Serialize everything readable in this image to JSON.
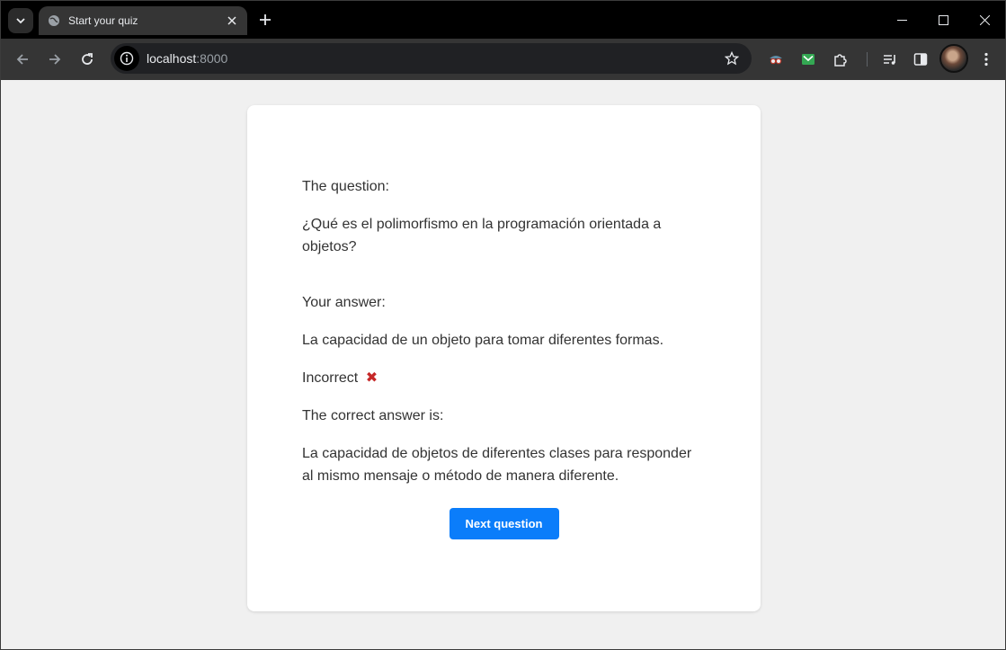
{
  "browser": {
    "tab_title": "Start your quiz",
    "url_host": "localhost",
    "url_port": ":8000",
    "icons": [
      "tab-search-icon",
      "globe-icon",
      "close-icon",
      "plus-icon",
      "minimize-icon",
      "maximize-icon",
      "window-close-icon",
      "back-icon",
      "forward-icon",
      "reload-icon",
      "site-info-icon",
      "star-icon",
      "extension-spy-icon",
      "extension-mail-icon",
      "puzzle-icon",
      "media-control-icon",
      "side-panel-icon",
      "more-icon"
    ]
  },
  "quiz": {
    "question_label": "The question:",
    "question_text": "¿Qué es el polimorfismo en la programación orientada a objetos?",
    "your_answer_label": "Your answer:",
    "your_answer_text": "La capacidad de un objeto para tomar diferentes formas.",
    "result_text": "Incorrect",
    "result_mark": "✖",
    "correct_answer_label": "The correct answer is:",
    "correct_answer_text": "La capacidad de objetos de diferentes clases para responder al mismo mensaje o método de manera diferente.",
    "next_button": "Next question"
  },
  "colors": {
    "accent": "#0b7dfa",
    "incorrect": "#c62828",
    "page_background": "#f0f0f0"
  }
}
